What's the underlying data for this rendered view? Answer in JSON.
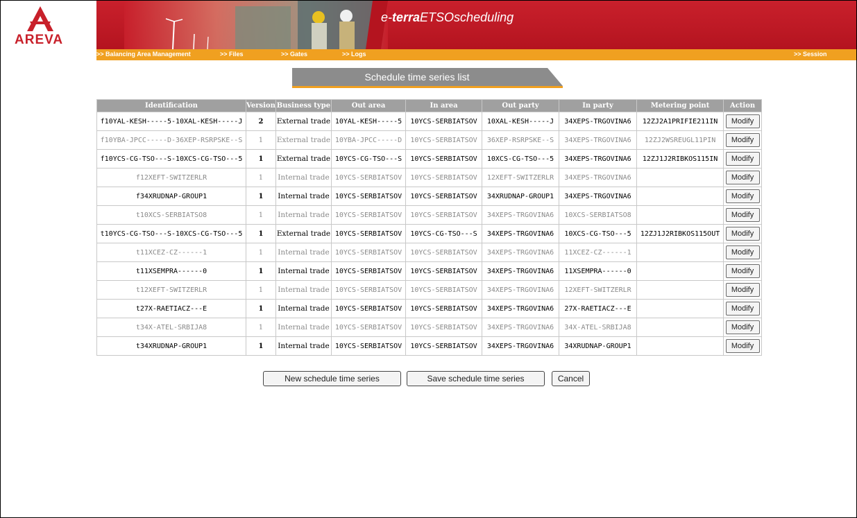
{
  "brand": {
    "logo_text": "AREVA",
    "app_prefix": "e-",
    "app_bold": "terra",
    "app_rest": "ETSOscheduling"
  },
  "nav": {
    "balancing": ">> Balancing Area Management",
    "files": ">> Files",
    "gates": ">> Gates",
    "logs": ">> Logs",
    "session": ">> Session"
  },
  "page_title": "Schedule time series list",
  "table": {
    "headers": [
      "Identification",
      "Version",
      "Business type",
      "Out area",
      "In area",
      "Out party",
      "In party",
      "Metering point",
      "Action"
    ],
    "rows": [
      {
        "id": "f10YAL-KESH-----5-10XAL-KESH-----J",
        "version": "2",
        "btype": "External trade",
        "out_area": "10YAL-KESH-----5",
        "in_area": "10YCS-SERBIATSOV",
        "out_party": "10XAL-KESH-----J",
        "in_party": "34XEPS-TRGOVINA6",
        "metering": "12ZJ2A1PRIFIE211IN",
        "action": "Modify"
      },
      {
        "id": "f10YBA-JPCC-----D-36XEP-RSRPSKE--S",
        "version": "1",
        "btype": "External trade",
        "out_area": "10YBA-JPCC-----D",
        "in_area": "10YCS-SERBIATSOV",
        "out_party": "36XEP-RSRPSKE--S",
        "in_party": "34XEPS-TRGOVINA6",
        "metering": "12ZJ2WSREUGL11PIN",
        "action": "Modify"
      },
      {
        "id": "f10YCS-CG-TSO---S-10XCS-CG-TSO---5",
        "version": "1",
        "btype": "External trade",
        "out_area": "10YCS-CG-TSO---S",
        "in_area": "10YCS-SERBIATSOV",
        "out_party": "10XCS-CG-TSO---5",
        "in_party": "34XEPS-TRGOVINA6",
        "metering": "12ZJ1J2RIBKOS115IN",
        "action": "Modify"
      },
      {
        "id": "f12XEFT-SWITZERLR",
        "version": "1",
        "btype": "Internal trade",
        "out_area": "10YCS-SERBIATSOV",
        "in_area": "10YCS-SERBIATSOV",
        "out_party": "12XEFT-SWITZERLR",
        "in_party": "34XEPS-TRGOVINA6",
        "metering": "",
        "action": "Modify"
      },
      {
        "id": "f34XRUDNAP-GROUP1",
        "version": "1",
        "btype": "Internal trade",
        "out_area": "10YCS-SERBIATSOV",
        "in_area": "10YCS-SERBIATSOV",
        "out_party": "34XRUDNAP-GROUP1",
        "in_party": "34XEPS-TRGOVINA6",
        "metering": "",
        "action": "Modify"
      },
      {
        "id": "t10XCS-SERBIATSO8",
        "version": "1",
        "btype": "Internal trade",
        "out_area": "10YCS-SERBIATSOV",
        "in_area": "10YCS-SERBIATSOV",
        "out_party": "34XEPS-TRGOVINA6",
        "in_party": "10XCS-SERBIATSO8",
        "metering": "",
        "action": "Modify"
      },
      {
        "id": "t10YCS-CG-TSO---S-10XCS-CG-TSO---5",
        "version": "1",
        "btype": "External trade",
        "out_area": "10YCS-SERBIATSOV",
        "in_area": "10YCS-CG-TSO---S",
        "out_party": "34XEPS-TRGOVINA6",
        "in_party": "10XCS-CG-TSO---5",
        "metering": "12ZJ1J2RIBKOS115OUT",
        "action": "Modify"
      },
      {
        "id": "t11XCEZ-CZ------1",
        "version": "1",
        "btype": "Internal trade",
        "out_area": "10YCS-SERBIATSOV",
        "in_area": "10YCS-SERBIATSOV",
        "out_party": "34XEPS-TRGOVINA6",
        "in_party": "11XCEZ-CZ------1",
        "metering": "",
        "action": "Modify"
      },
      {
        "id": "t11XSEMPRA------0",
        "version": "1",
        "btype": "Internal trade",
        "out_area": "10YCS-SERBIATSOV",
        "in_area": "10YCS-SERBIATSOV",
        "out_party": "34XEPS-TRGOVINA6",
        "in_party": "11XSEMPRA------0",
        "metering": "",
        "action": "Modify"
      },
      {
        "id": "t12XEFT-SWITZERLR",
        "version": "1",
        "btype": "Internal trade",
        "out_area": "10YCS-SERBIATSOV",
        "in_area": "10YCS-SERBIATSOV",
        "out_party": "34XEPS-TRGOVINA6",
        "in_party": "12XEFT-SWITZERLR",
        "metering": "",
        "action": "Modify"
      },
      {
        "id": "t27X-RAETIACZ---E",
        "version": "1",
        "btype": "Internal trade",
        "out_area": "10YCS-SERBIATSOV",
        "in_area": "10YCS-SERBIATSOV",
        "out_party": "34XEPS-TRGOVINA6",
        "in_party": "27X-RAETIACZ---E",
        "metering": "",
        "action": "Modify"
      },
      {
        "id": "t34X-ATEL-SRBIJA8",
        "version": "1",
        "btype": "Internal trade",
        "out_area": "10YCS-SERBIATSOV",
        "in_area": "10YCS-SERBIATSOV",
        "out_party": "34XEPS-TRGOVINA6",
        "in_party": "34X-ATEL-SRBIJA8",
        "metering": "",
        "action": "Modify"
      },
      {
        "id": "t34XRUDNAP-GROUP1",
        "version": "1",
        "btype": "Internal trade",
        "out_area": "10YCS-SERBIATSOV",
        "in_area": "10YCS-SERBIATSOV",
        "out_party": "34XEPS-TRGOVINA6",
        "in_party": "34XRUDNAP-GROUP1",
        "metering": "",
        "action": "Modify"
      }
    ],
    "dim_rows": [
      1,
      3,
      5,
      7,
      9,
      11
    ]
  },
  "buttons": {
    "new": "New schedule time series",
    "save": "Save schedule time series",
    "cancel": "Cancel"
  },
  "colors": {
    "brand_red": "#c9202c",
    "nav_orange": "#f0a020",
    "title_tab_gray": "#8c8c8c",
    "header_gray": "#a0a0a0"
  }
}
